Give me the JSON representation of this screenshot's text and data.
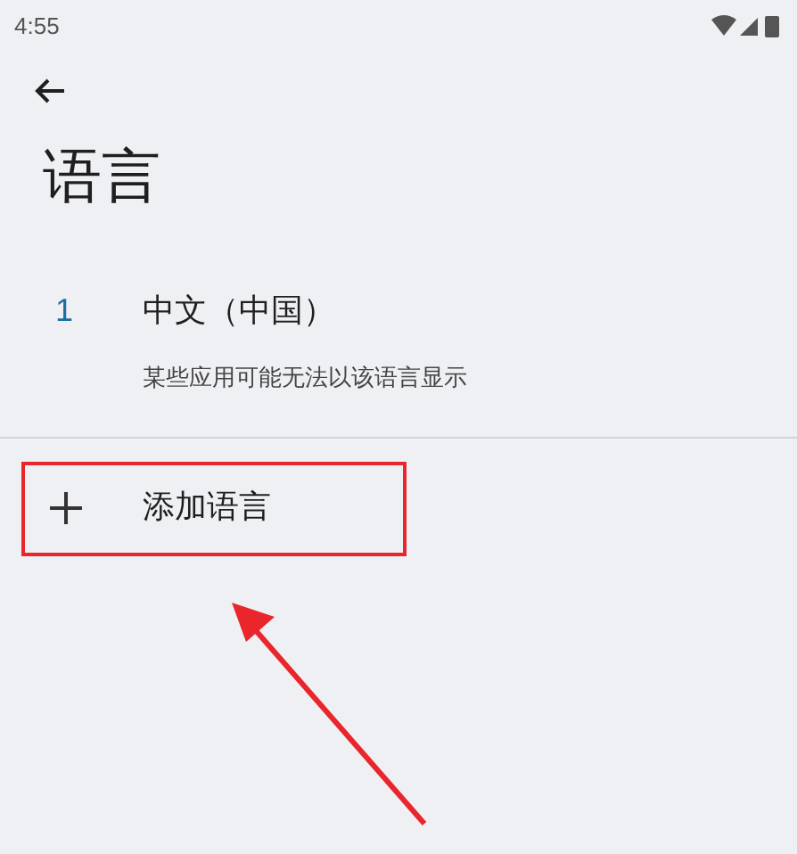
{
  "status_bar": {
    "time": "4:55"
  },
  "title": "语言",
  "languages": [
    {
      "rank": "1",
      "name": "中文（中国）",
      "note": "某些应用可能无法以该语言显示"
    }
  ],
  "add_language": {
    "label": "添加语言",
    "highlighted": true
  },
  "annotation_arrow": true
}
